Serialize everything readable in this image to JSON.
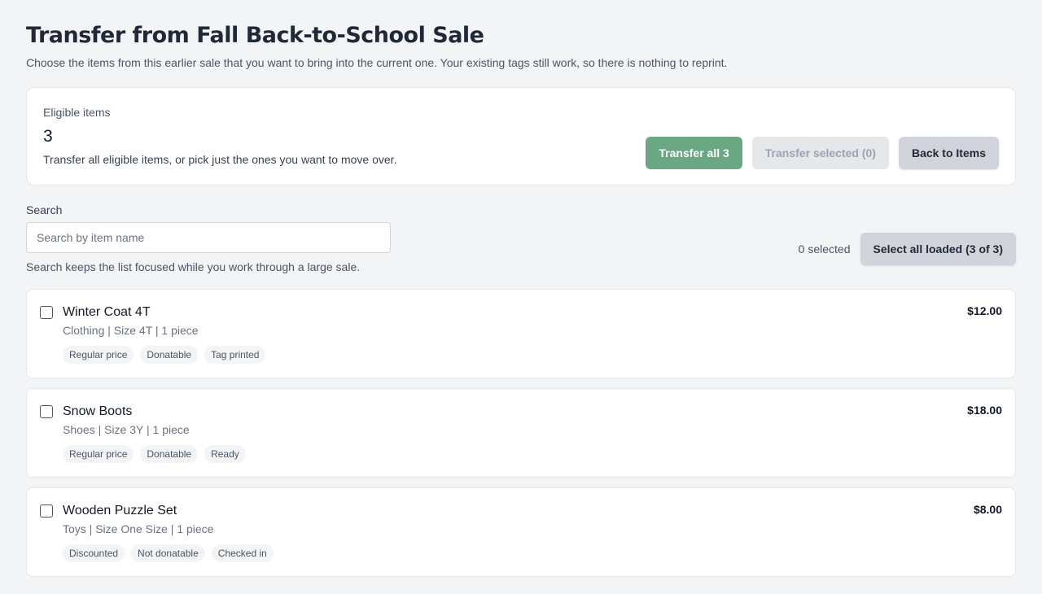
{
  "header": {
    "title": "Transfer from Fall Back-to-School Sale",
    "subtitle": "Choose the items from this earlier sale that you want to bring into the current one. Your existing tags still work, so there is nothing to reprint."
  },
  "summary": {
    "label": "Eligible items",
    "count": "3",
    "help": "Transfer all eligible items, or pick just the ones you want to move over.",
    "transfer_all_label": "Transfer all 3",
    "transfer_selected_label": "Transfer selected (0)",
    "back_label": "Back to Items"
  },
  "search": {
    "label": "Search",
    "placeholder": "Search by item name",
    "value": "",
    "help": "Search keeps the list focused while you work through a large sale.",
    "selected_count": "0 selected",
    "select_all_label": "Select all loaded (3 of 3)"
  },
  "items": [
    {
      "name": "Winter Coat 4T",
      "meta": "Clothing | Size 4T | 1 piece",
      "price": "$12.00",
      "tags": [
        "Regular price",
        "Donatable",
        "Tag printed"
      ]
    },
    {
      "name": "Snow Boots",
      "meta": "Shoes | Size 3Y | 1 piece",
      "price": "$18.00",
      "tags": [
        "Regular price",
        "Donatable",
        "Ready"
      ]
    },
    {
      "name": "Wooden Puzzle Set",
      "meta": "Toys | Size One Size | 1 piece",
      "price": "$8.00",
      "tags": [
        "Discounted",
        "Not donatable",
        "Checked in"
      ]
    }
  ],
  "colors": {
    "accent_green": "#6aa884",
    "background": "#f3f4f6"
  }
}
